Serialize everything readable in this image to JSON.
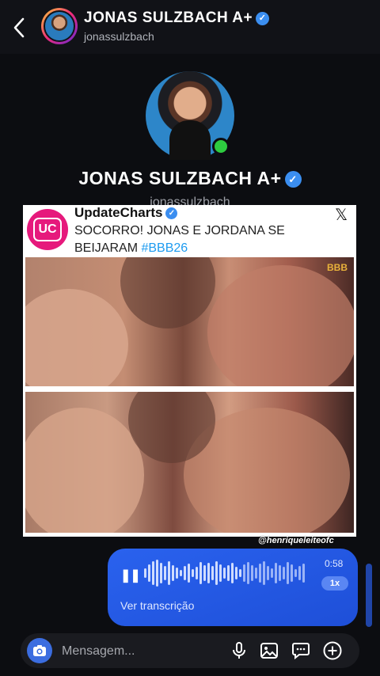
{
  "header": {
    "name": "JONAS SULZBACH A+",
    "username": "jonassulzbach"
  },
  "profile": {
    "name": "JONAS SULZBACH A+",
    "username": "jonassulzbach",
    "online": true
  },
  "post": {
    "logo_text": "UC",
    "author": "UpdateCharts",
    "text": "SOCORRO! JONAS E JORDANA SE BEIJARAM",
    "hashtag": "#BBB26",
    "watermark_img": "BBB",
    "credit": "@henriqueleiteofc"
  },
  "voice_message": {
    "duration": "0:58",
    "speed": "1x",
    "transcription_label": "Ver transcrição"
  },
  "composer": {
    "placeholder": "Mensagem..."
  },
  "colors": {
    "background": "#0c0d11",
    "voice_bubble": "#2a62ee",
    "verified": "#3b8ef0",
    "online": "#2ecc40",
    "hashtag": "#1d9bf0",
    "logo": "#e6197c"
  }
}
